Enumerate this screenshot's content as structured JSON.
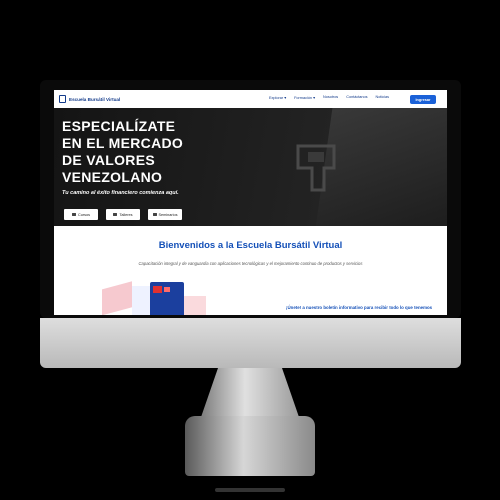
{
  "site": {
    "brand_name": "Escuela Bursátil Virtual"
  },
  "nav": {
    "items": [
      {
        "label": "Explorar ▾"
      },
      {
        "label": "Formación ▾"
      },
      {
        "label": "Nosotros"
      },
      {
        "label": "Contáctanos"
      },
      {
        "label": "Noticias"
      }
    ],
    "login_label": "Ingresar",
    "login_color": "#1a61d8"
  },
  "hero": {
    "title_lines": [
      "ESPECIALÍZATE",
      "EN EL MERCADO",
      "DE VALORES",
      "VENEZOLANO"
    ],
    "subtitle": "Tu camino al éxito financiero comienza aquí.",
    "buttons": [
      {
        "label": "Cursos",
        "icon": "book-icon"
      },
      {
        "label": "Talleres",
        "icon": "laptop-icon"
      },
      {
        "label": "Seminarios",
        "icon": "presentation-icon"
      }
    ]
  },
  "welcome": {
    "title": "Bienvenidos a la Escuela Bursátil Virtual",
    "description": "Capacitación integral y de vanguardia con aplicaciones tecnológicas y el mejoramiento continuo de productos y servicios",
    "accent_color": "#1450b8"
  },
  "newsletter": {
    "text": "¡Únete! a nuestro boletín informativo para recibir todo lo que tenemos"
  }
}
